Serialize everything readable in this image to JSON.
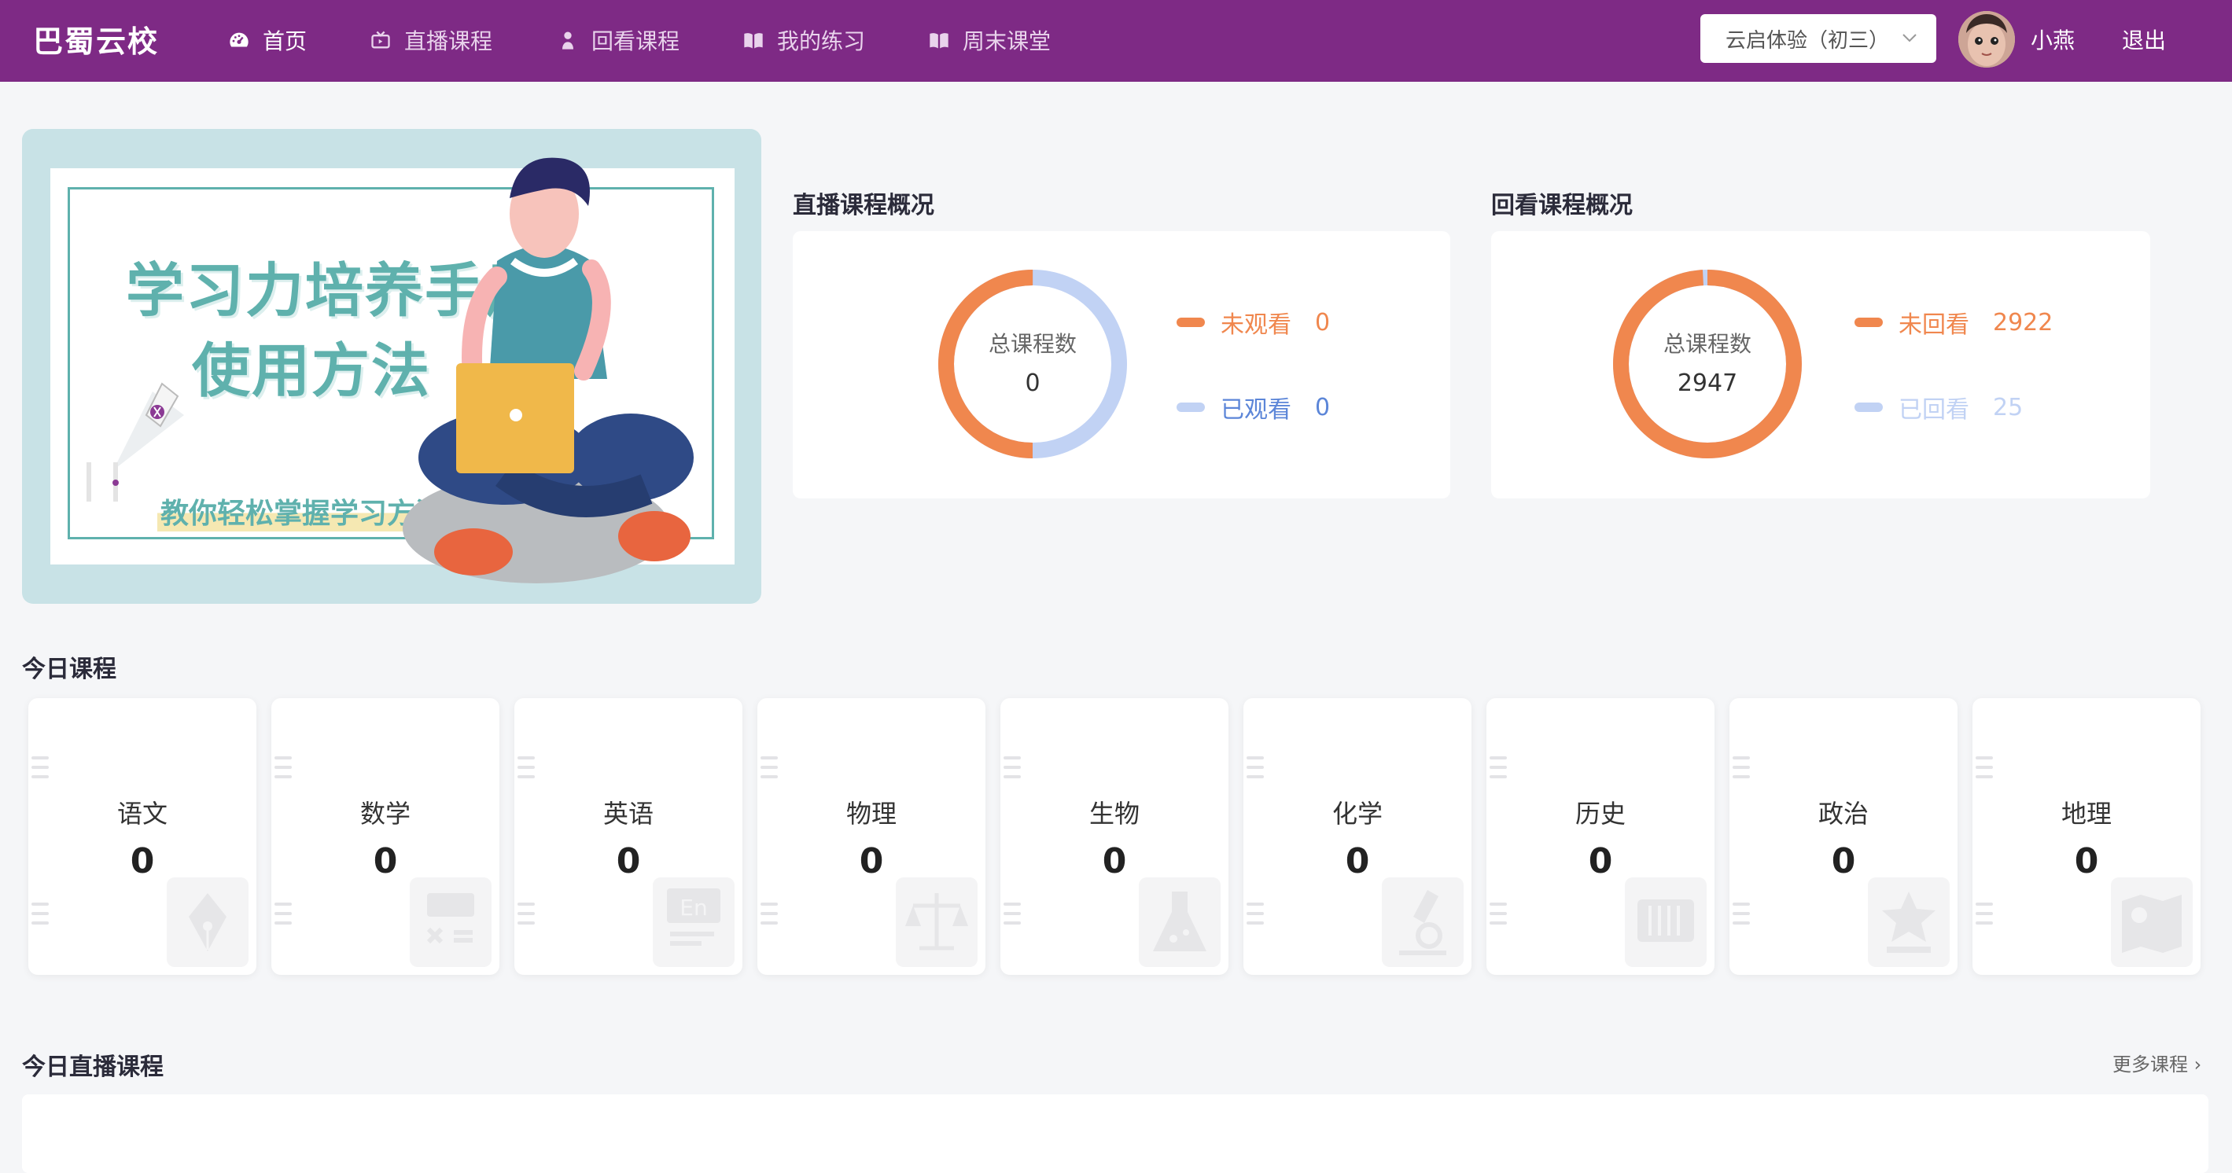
{
  "app": {
    "logo": "巴蜀云校"
  },
  "nav": {
    "items": [
      {
        "label": "首页",
        "icon": "dashboard-icon",
        "active": true
      },
      {
        "label": "直播课程",
        "icon": "tv-icon",
        "active": false
      },
      {
        "label": "回看课程",
        "icon": "person-icon",
        "active": false
      },
      {
        "label": "我的练习",
        "icon": "book-icon",
        "active": false
      },
      {
        "label": "周末课堂",
        "icon": "book-icon",
        "active": false
      }
    ]
  },
  "header": {
    "term_select": {
      "value": "云启体验（初三）"
    },
    "user": {
      "name": "小燕"
    },
    "logout": "退出"
  },
  "banner": {
    "title_line1": "学习力培养手册",
    "title_line2": "使用方法",
    "subtitle": "教你轻松掌握学习方法"
  },
  "live_overview": {
    "title": "直播课程概况",
    "total_label": "总课程数",
    "total": "0",
    "unwatched_label": "未观看",
    "unwatched": "0",
    "watched_label": "已观看",
    "watched": "0",
    "unwatched_fraction": 0.5,
    "watched_fraction": 0.5
  },
  "replay_overview": {
    "title": "回看课程概况",
    "total_label": "总课程数",
    "total": "2947",
    "unwatched_label": "未回看",
    "unwatched": "2922",
    "watched_label": "已回看",
    "watched": "25"
  },
  "colors": {
    "primary": "#7e2a85",
    "orange": "#f0874e",
    "blue": "#c1d2f4",
    "blue_text": "#5c86d8"
  },
  "today_courses": {
    "title": "今日课程",
    "subjects": [
      {
        "name": "语文",
        "count": "0",
        "icon": "pen-nib-icon"
      },
      {
        "name": "数学",
        "count": "0",
        "icon": "math-icon"
      },
      {
        "name": "英语",
        "count": "0",
        "icon": "english-icon"
      },
      {
        "name": "物理",
        "count": "0",
        "icon": "scale-icon"
      },
      {
        "name": "生物",
        "count": "0",
        "icon": "flask-icon"
      },
      {
        "name": "化学",
        "count": "0",
        "icon": "microscope-icon"
      },
      {
        "name": "历史",
        "count": "0",
        "icon": "scroll-icon"
      },
      {
        "name": "政治",
        "count": "0",
        "icon": "star-badge-icon"
      },
      {
        "name": "地理",
        "count": "0",
        "icon": "map-icon"
      }
    ]
  },
  "today_live": {
    "title": "今日直播课程",
    "more": "更多课程"
  }
}
